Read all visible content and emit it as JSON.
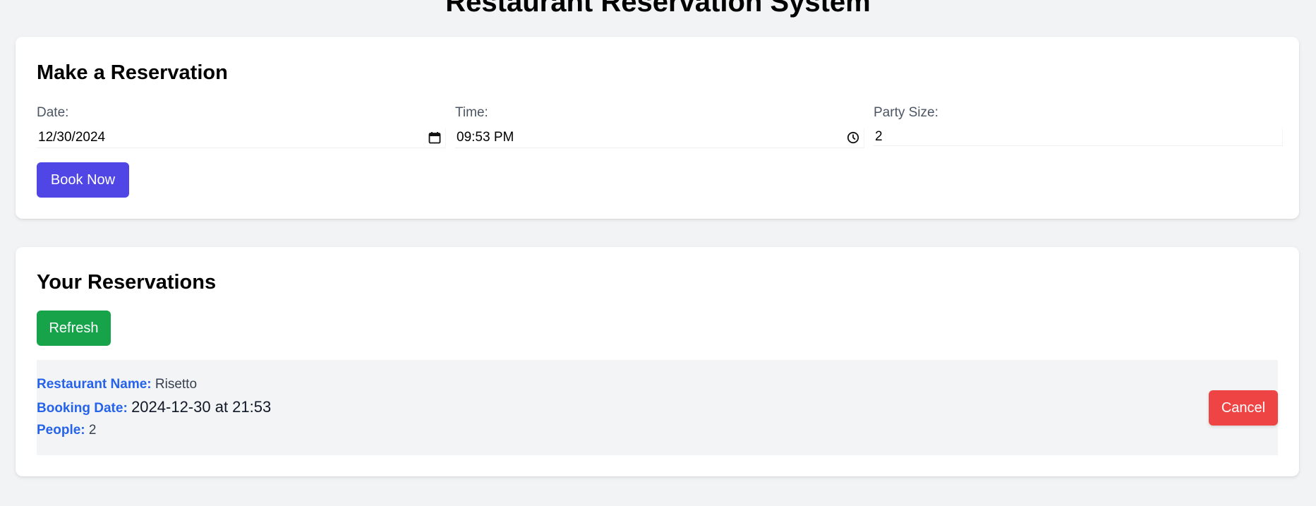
{
  "page": {
    "title": "Restaurant Reservation System"
  },
  "make_reservation": {
    "heading": "Make a Reservation",
    "date": {
      "label": "Date:",
      "value": "12/30/2024",
      "icon": "calendar-icon"
    },
    "time": {
      "label": "Time:",
      "value": "09:53 PM",
      "icon": "clock-icon"
    },
    "party_size": {
      "label": "Party Size:",
      "value": "2"
    },
    "book_button": {
      "label": "Book Now",
      "color": "#4f46e5"
    }
  },
  "your_reservations": {
    "heading": "Your Reservations",
    "refresh_button": {
      "label": "Refresh",
      "color": "#16a34a"
    },
    "items": [
      {
        "restaurant_label": "Restaurant Name:",
        "restaurant_value": "Risetto",
        "booking_label": "Booking Date:",
        "booking_value": "2024-12-30 at 21:53",
        "people_label": "People:",
        "people_value": "2",
        "cancel_label": "Cancel"
      }
    ],
    "cancel_color": "#ef4444",
    "label_color": "#2563eb"
  }
}
